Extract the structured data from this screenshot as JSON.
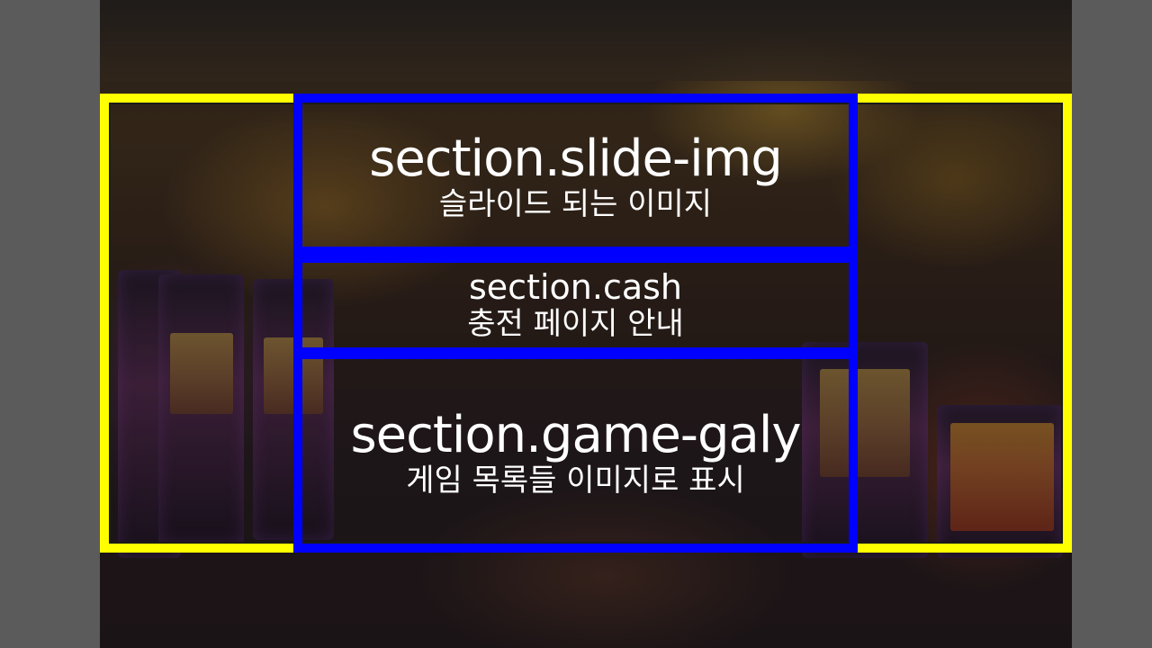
{
  "sections": {
    "slide_img": {
      "selector": "section.slide-img",
      "description": "슬라이드 되는 이미지"
    },
    "cash": {
      "selector": "section.cash",
      "description": "충전 페이지 안내"
    },
    "game_galy": {
      "selector": "section.game-galy",
      "description": "게임 목록들 이미지로 표시"
    }
  },
  "colors": {
    "outer_frame": "#ffff00",
    "section_frame": "#0000ff",
    "page_background": "#5b5b5b",
    "text": "#ffffff"
  }
}
